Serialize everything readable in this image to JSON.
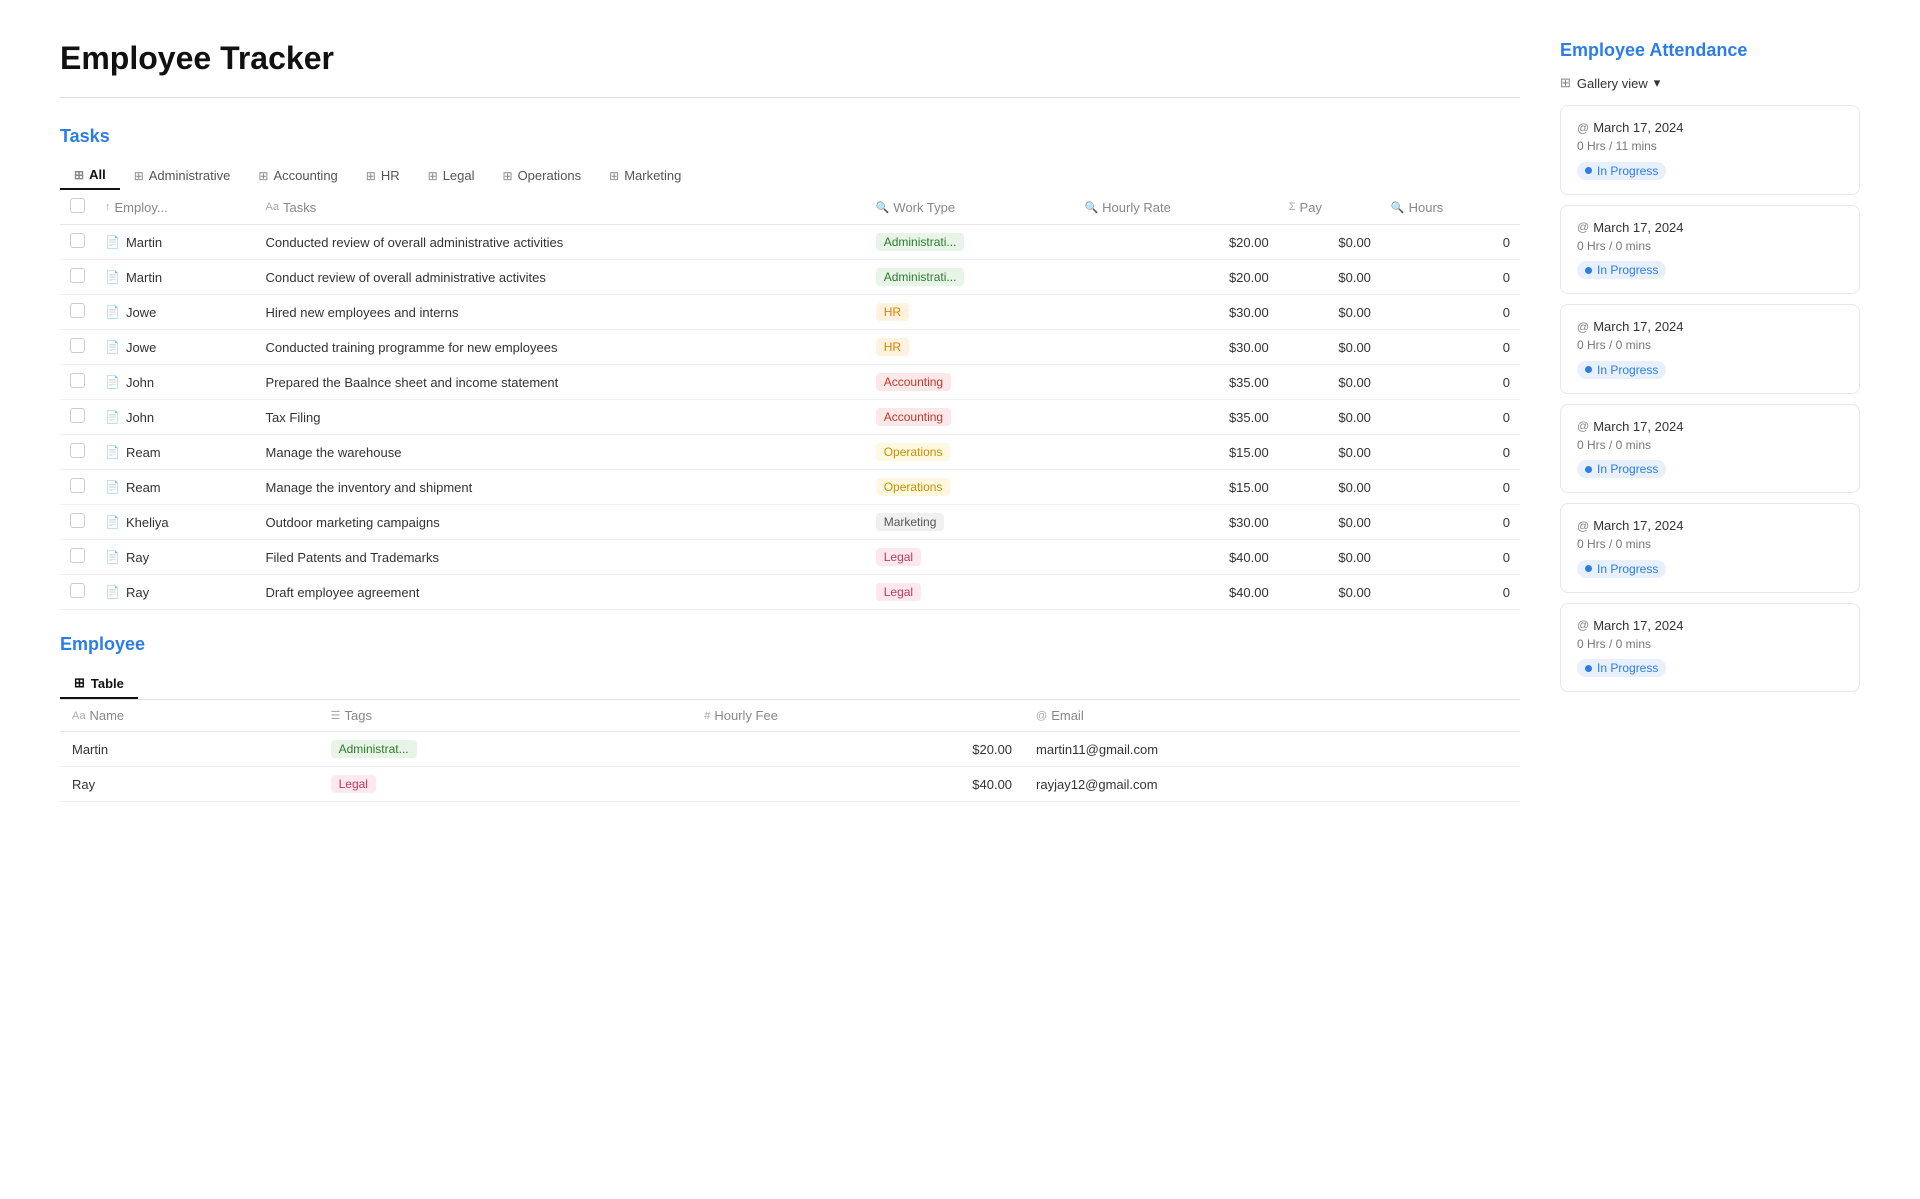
{
  "page": {
    "title": "Employee Tracker"
  },
  "tasks_section": {
    "title": "Tasks",
    "tabs": [
      {
        "label": "All",
        "active": true
      },
      {
        "label": "Administrative",
        "active": false
      },
      {
        "label": "Accounting",
        "active": false
      },
      {
        "label": "HR",
        "active": false
      },
      {
        "label": "Legal",
        "active": false
      },
      {
        "label": "Operations",
        "active": false
      },
      {
        "label": "Marketing",
        "active": false
      }
    ],
    "columns": [
      {
        "label": "Employ...",
        "type": "Aa"
      },
      {
        "label": "Tasks",
        "type": "Aa"
      },
      {
        "label": "Work Type",
        "type": "search"
      },
      {
        "label": "Hourly Rate",
        "type": "search"
      },
      {
        "label": "Pay",
        "type": "sigma"
      },
      {
        "label": "Hours",
        "type": "search"
      }
    ],
    "rows": [
      {
        "employee": "Martin",
        "task": "Conducted review of overall administrative activities",
        "work_type": "Administrati...",
        "work_type_category": "admin",
        "hourly_rate": "$20.00",
        "pay": "$0.00",
        "hours": "0"
      },
      {
        "employee": "Martin",
        "task": "Conduct review of overall administrative activites",
        "work_type": "Administrati...",
        "work_type_category": "admin",
        "hourly_rate": "$20.00",
        "pay": "$0.00",
        "hours": "0"
      },
      {
        "employee": "Jowe",
        "task": "Hired new employees and interns",
        "work_type": "HR",
        "work_type_category": "hr",
        "hourly_rate": "$30.00",
        "pay": "$0.00",
        "hours": "0"
      },
      {
        "employee": "Jowe",
        "task": "Conducted training programme for new employees",
        "work_type": "HR",
        "work_type_category": "hr",
        "hourly_rate": "$30.00",
        "pay": "$0.00",
        "hours": "0"
      },
      {
        "employee": "John",
        "task": "Prepared the Baalnce sheet and income statement",
        "work_type": "Accounting",
        "work_type_category": "accounting",
        "hourly_rate": "$35.00",
        "pay": "$0.00",
        "hours": "0"
      },
      {
        "employee": "John",
        "task": "Tax Filing",
        "work_type": "Accounting",
        "work_type_category": "accounting",
        "hourly_rate": "$35.00",
        "pay": "$0.00",
        "hours": "0"
      },
      {
        "employee": "Ream",
        "task": "Manage the warehouse",
        "work_type": "Operations",
        "work_type_category": "operations",
        "hourly_rate": "$15.00",
        "pay": "$0.00",
        "hours": "0"
      },
      {
        "employee": "Ream",
        "task": "Manage the inventory and shipment",
        "work_type": "Operations",
        "work_type_category": "operations",
        "hourly_rate": "$15.00",
        "pay": "$0.00",
        "hours": "0"
      },
      {
        "employee": "Kheliya",
        "task": "Outdoor marketing campaigns",
        "work_type": "Marketing",
        "work_type_category": "marketing",
        "hourly_rate": "$30.00",
        "pay": "$0.00",
        "hours": "0"
      },
      {
        "employee": "Ray",
        "task": "Filed Patents and Trademarks",
        "work_type": "Legal",
        "work_type_category": "legal",
        "hourly_rate": "$40.00",
        "pay": "$0.00",
        "hours": "0"
      },
      {
        "employee": "Ray",
        "task": "Draft employee agreement",
        "work_type": "Legal",
        "work_type_category": "legal",
        "hourly_rate": "$40.00",
        "pay": "$0.00",
        "hours": "0"
      }
    ]
  },
  "employee_section": {
    "title": "Employee",
    "tab_label": "Table",
    "columns": [
      {
        "label": "Name",
        "type": "Aa"
      },
      {
        "label": "Tags",
        "type": "list"
      },
      {
        "label": "Hourly Fee",
        "type": "hash"
      },
      {
        "label": "Email",
        "type": "at"
      }
    ],
    "rows": [
      {
        "name": "Martin",
        "tag": "Administrat...",
        "tag_category": "admin",
        "hourly_fee": "$20.00",
        "email": "martin11@gmail.com"
      },
      {
        "name": "Ray",
        "tag": "Legal",
        "tag_category": "legal",
        "hourly_fee": "$40.00",
        "email": "rayjay12@gmail.com"
      }
    ]
  },
  "attendance_section": {
    "title": "Employee Attendance",
    "view_label": "Gallery view",
    "cards": [
      {
        "date": "March 17, 2024",
        "time": "0 Hrs / 11 mins",
        "status": "In Progress"
      },
      {
        "date": "March 17, 2024",
        "time": "0 Hrs / 0 mins",
        "status": "In Progress"
      },
      {
        "date": "March 17, 2024",
        "time": "0 Hrs / 0 mins",
        "status": "In Progress"
      },
      {
        "date": "March 17, 2024",
        "time": "0 Hrs / 0 mins",
        "status": "In Progress"
      },
      {
        "date": "March 17, 2024",
        "time": "0 Hrs / 0 mins",
        "status": "In Progress"
      },
      {
        "date": "March 17, 2024",
        "time": "0 Hrs / 0 mins",
        "status": "In Progress"
      }
    ]
  }
}
